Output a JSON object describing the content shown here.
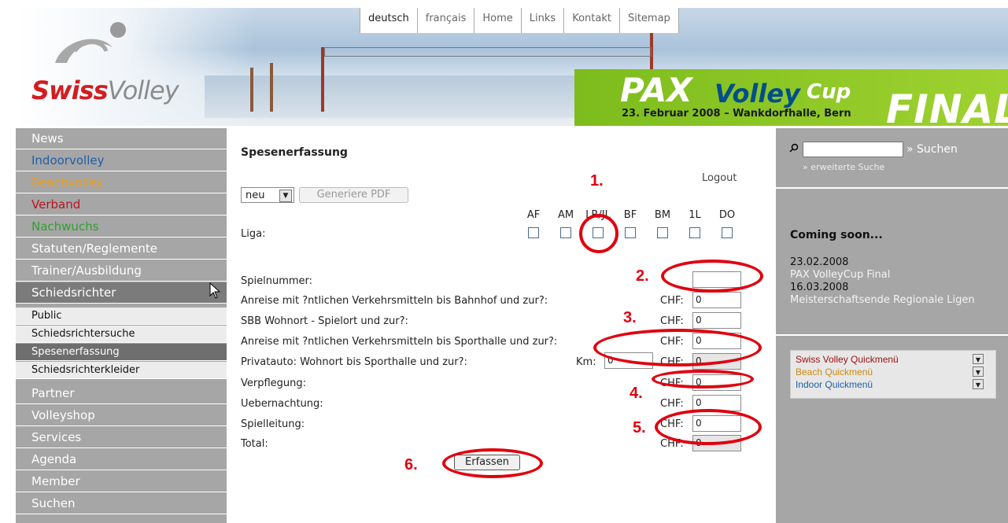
{
  "header": {
    "logo": {
      "part1": "Swiss",
      "part2": "Volley"
    },
    "topnav": [
      "deutsch",
      "français",
      "Home",
      "Links",
      "Kontakt",
      "Sitemap"
    ],
    "banner": {
      "pax": "PAX",
      "volley": "Volley",
      "cup": "Cup",
      "final": "FINAL",
      "date": "23. Februar 2008 – Wankdorfhalle, Bern"
    }
  },
  "leftnav": {
    "items": [
      {
        "label": "News",
        "color": "#ffffff"
      },
      {
        "label": "Indoorvolley",
        "color": "#1f5fa8"
      },
      {
        "label": "Beachvolley",
        "color": "#e8a020"
      },
      {
        "label": "Verband",
        "color": "#b8141c"
      },
      {
        "label": "Nachwuchs",
        "color": "#2fa02f"
      },
      {
        "label": "Statuten/Reglemente",
        "color": "#ffffff"
      },
      {
        "label": "Trainer/Ausbildung",
        "color": "#ffffff"
      },
      {
        "label": "Schiedsrichter",
        "color": "#ffffff"
      }
    ],
    "subitems": [
      "Public",
      "Schiedsrichtersuche",
      "Spesenerfassung",
      "Schiedsrichterkleider"
    ],
    "items2": [
      "Partner",
      "Volleyshop",
      "Services",
      "Agenda",
      "Member",
      "Suchen"
    ]
  },
  "main": {
    "title": "Spesenerfassung",
    "logout": "Logout",
    "select_value": "neu",
    "pdf_button": "Generiere PDF",
    "liga_label": "Liga:",
    "leagues": [
      "AF",
      "AM",
      "LR/JL",
      "BF",
      "BM",
      "1L",
      "DO"
    ],
    "rows": [
      {
        "label": "Spielnummer:",
        "chf": "",
        "value": ""
      },
      {
        "label": "Anreise mit ?ntlichen Verkehrsmitteln bis Bahnhof und zur?:",
        "chf": "CHF:",
        "value": "0"
      },
      {
        "label": "SBB Wohnort - Spielort und zur?:",
        "chf": "CHF:",
        "value": "0"
      },
      {
        "label": "Anreise mit ?ntlichen Verkehrsmitteln bis Sporthalle und zur?:",
        "chf": "CHF:",
        "value": "0"
      },
      {
        "label": "Privatauto: Wohnort bis Sporthalle und zur?:",
        "chf": "CHF:",
        "value": "0"
      },
      {
        "label": "Verpflegung:",
        "chf": "CHF:",
        "value": "0"
      },
      {
        "label": "Uebernachtung:",
        "chf": "CHF:",
        "value": "0"
      },
      {
        "label": "Spielleitung:",
        "chf": "CHF:",
        "value": "0"
      },
      {
        "label": "Total:",
        "chf": "CHF:",
        "value": "0"
      }
    ],
    "km_label": "Km:",
    "km_value": "0",
    "submit": "Erfassen"
  },
  "annotations": [
    "1.",
    "2.",
    "3.",
    "4.",
    "5.",
    "6."
  ],
  "right": {
    "search_link": "» Suchen",
    "advanced_search": "» erweiterte Suche",
    "coming_soon": "Coming soon...",
    "events": [
      {
        "date": "23.02.2008",
        "title": "PAX VolleyCup Final"
      },
      {
        "date": "16.03.2008",
        "title": "Meisterschaftsende Regionale Ligen"
      }
    ],
    "quickmenus": [
      {
        "label": "Swiss Volley Quickmenü",
        "color": "#a01010"
      },
      {
        "label": "Beach Quickmenü",
        "color": "#d08a10"
      },
      {
        "label": "Indoor Quickmenü",
        "color": "#1f5fa8"
      }
    ]
  }
}
